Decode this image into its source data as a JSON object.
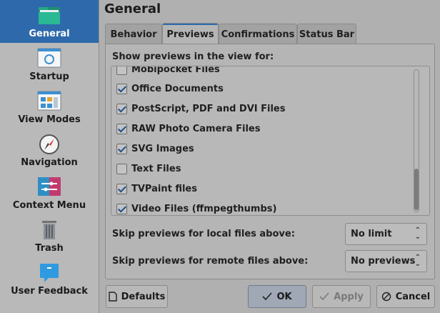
{
  "sidebar": {
    "items": [
      {
        "label": "General",
        "icon": "folder-icon"
      },
      {
        "label": "Startup",
        "icon": "startup-window-icon"
      },
      {
        "label": "View Modes",
        "icon": "view-modes-icon"
      },
      {
        "label": "Navigation",
        "icon": "compass-icon"
      },
      {
        "label": "Context Menu",
        "icon": "context-menu-icon"
      },
      {
        "label": "Trash",
        "icon": "trash-icon"
      },
      {
        "label": "User Feedback",
        "icon": "feedback-icon"
      }
    ],
    "active_color": "#2e6aab"
  },
  "page": {
    "title": "General"
  },
  "tabs": [
    "Behavior",
    "Previews",
    "Confirmations",
    "Status Bar"
  ],
  "previews": {
    "section_label": "Show previews in the view for:",
    "partial_item": "Mobipocket Files",
    "items": [
      {
        "label": "Office Documents",
        "checked": true
      },
      {
        "label": "PostScript, PDF and DVI Files",
        "checked": true
      },
      {
        "label": "RAW Photo Camera Files",
        "checked": true
      },
      {
        "label": "SVG Images",
        "checked": true
      },
      {
        "label": "Text Files",
        "checked": false
      },
      {
        "label": "TVPaint files",
        "checked": true
      },
      {
        "label": "Video Files (ffmpegthumbs)",
        "checked": true
      }
    ]
  },
  "options": {
    "local_label": "Skip previews for local files above:",
    "local_value": "No limit",
    "remote_label": "Skip previews for remote files above:",
    "remote_value": "No previews"
  },
  "buttons": {
    "defaults": "Defaults",
    "ok": "OK",
    "apply": "Apply",
    "cancel": "Cancel"
  }
}
